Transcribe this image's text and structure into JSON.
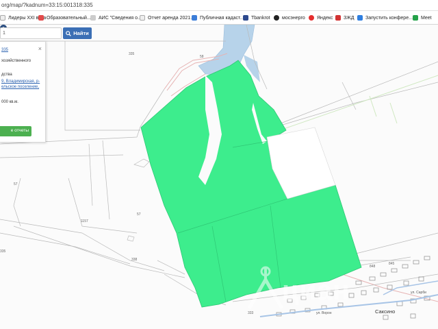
{
  "browser": {
    "url": "org/map/?kadnum=33:15:001318:335"
  },
  "bookmarks": [
    {
      "label": "Лидеры XXI века",
      "color": "#f0f0f0",
      "icon": "page-icon"
    },
    {
      "label": "Образовательный...",
      "color": "#e24b4b",
      "icon": "bookmark-icon"
    },
    {
      "label": "АИС \"Сведения о...",
      "color": "#c7c7c7",
      "icon": "page-icon"
    },
    {
      "label": "Отчет аренда 2021...",
      "color": "#f0f0f0",
      "icon": "page-icon"
    },
    {
      "label": "Публичная кадаст...",
      "color": "#3c7dd8",
      "icon": "map-icon"
    },
    {
      "label": "Tbankrot",
      "color": "#2e4a8e",
      "icon": "bookmark-icon"
    },
    {
      "label": "мосэнерго",
      "color": "#222222",
      "icon": "bookmark-icon"
    },
    {
      "label": "Яндекс",
      "color": "#e52e2e",
      "icon": "yandex-icon"
    },
    {
      "label": "ЗЖД",
      "color": "#d23333",
      "icon": "bookmark-icon"
    },
    {
      "label": "Запустить конфере...",
      "color": "#2f7fe0",
      "icon": "video-icon"
    },
    {
      "label": "Meet",
      "color": "#25a24a",
      "icon": "meet-icon"
    }
  ],
  "search": {
    "value": "1",
    "button_label": "Найти",
    "button_icon": "search-icon"
  },
  "info_card": {
    "cadastral": "335",
    "line1": "хозяйственного",
    "line2": "дства",
    "address": "9, Владимирская, р-",
    "settlement": "ельское поселение,",
    "area": "000 кв.м.",
    "report_button": "е отчеты"
  },
  "map": {
    "parcel_color": "#3ded8d",
    "road_color": "#e6b3b3",
    "water_color": "#b7d3ea",
    "parcel_labels": [
      "335",
      "58",
      "57",
      "57",
      "1157",
      "338",
      "335",
      "848",
      "845",
      "333"
    ],
    "town_label": "Саксино",
    "street_labels": [
      "ул. Ворон",
      "ул. Сарби"
    ],
    "marker_icon": "map-pin-icon",
    "watermark": "циан"
  }
}
